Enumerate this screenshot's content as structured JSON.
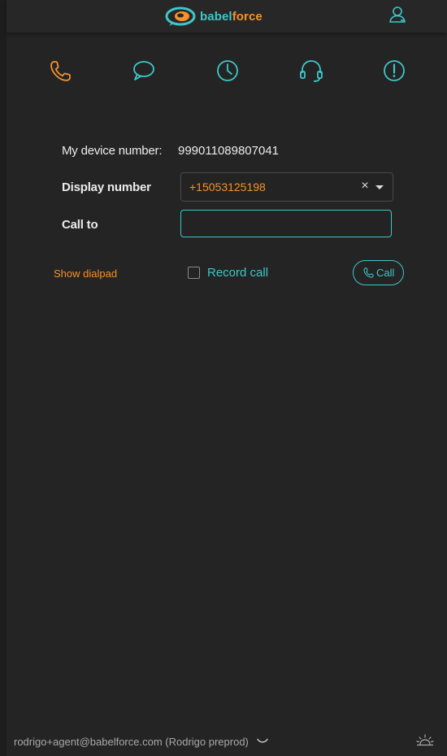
{
  "header": {
    "logo_babel": "babel",
    "logo_force": "force"
  },
  "nav": {
    "icons": [
      "phone-icon",
      "chat-icon",
      "clock-icon",
      "headset-icon",
      "alert-icon"
    ],
    "active": "phone-icon"
  },
  "form": {
    "device_label": "My device number:",
    "device_value": "999011089807041",
    "display_label": "Display number",
    "display_value": "+15053125198",
    "clear_symbol": "×",
    "call_to_label": "Call to",
    "call_to_value": "",
    "show_dialpad": "Show dialpad",
    "record_call": "Record call",
    "record_checked": false,
    "call_button": "Call"
  },
  "footer": {
    "account": "rodrigo+agent@babelforce.com (Rodrigo preprod)"
  },
  "colors": {
    "accent_teal": "#3ec7c9",
    "accent_orange": "#f5922b",
    "background": "#242424"
  }
}
